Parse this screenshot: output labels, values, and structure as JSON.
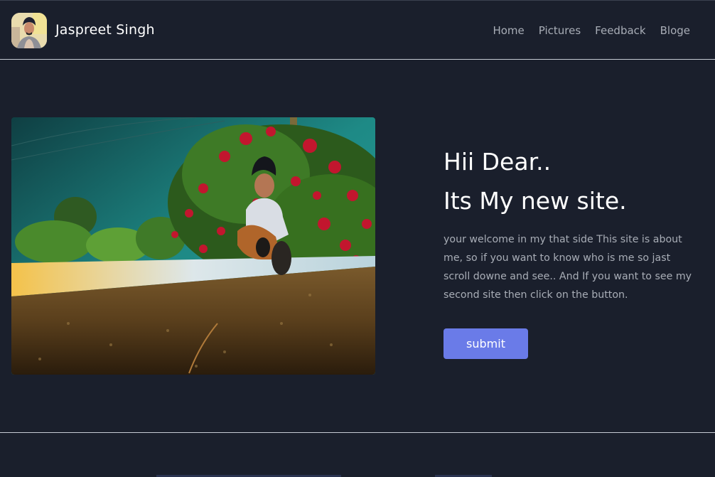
{
  "header": {
    "brand_name": "Jaspreet Singh",
    "avatar_icon": "profile-photo"
  },
  "nav": {
    "items": [
      {
        "label": "Home"
      },
      {
        "label": "Pictures"
      },
      {
        "label": "Feedback"
      },
      {
        "label": "Bloge"
      }
    ]
  },
  "hero": {
    "headline_line1": "Hii Dear..",
    "headline_line2": "Its My new site.",
    "description": "your welcome in my that side This site is about me, so if you want to know who is me so jast scroll downe and see.. And If you want to see my second site then click on the button.",
    "button_label": "submit"
  },
  "colors": {
    "background": "#1a1f2c",
    "accent": "#6a7be8",
    "muted_text": "#a8adb6"
  }
}
